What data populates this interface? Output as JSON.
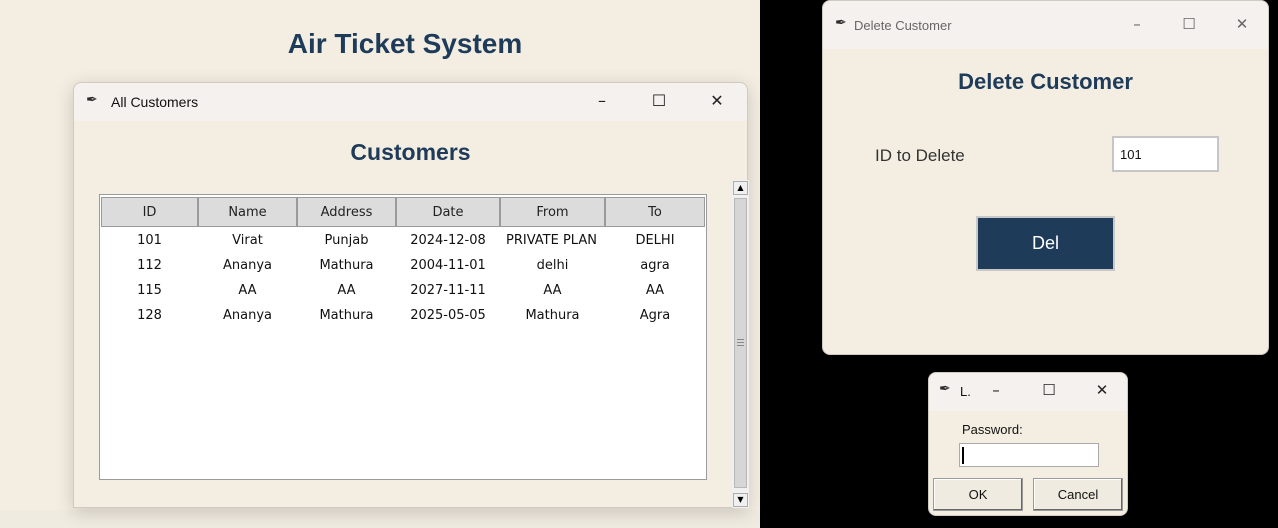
{
  "app": {
    "title": "Air Ticket System"
  },
  "customers_window": {
    "title": "All Customers",
    "heading": "Customers",
    "columns": [
      "ID",
      "Name",
      "Address",
      "Date",
      "From",
      "To"
    ],
    "rows": [
      [
        "101",
        "Virat",
        "Punjab",
        "2024-12-08",
        "PRIVATE PLAN",
        "DELHI"
      ],
      [
        "112",
        "Ananya",
        "Mathura",
        "2004-11-01",
        "delhi",
        "agra"
      ],
      [
        "115",
        "AA",
        "AA",
        "2027-11-11",
        "AA",
        "AA"
      ],
      [
        "128",
        "Ananya",
        "Mathura",
        "2025-05-05",
        "Mathura",
        "Agra"
      ]
    ]
  },
  "delete_window": {
    "title": "Delete Customer",
    "heading": "Delete Customer",
    "id_label": "ID to Delete",
    "id_value": "101",
    "del_label": "Del"
  },
  "login_window": {
    "title": "L.",
    "password_label": "Password:",
    "ok_label": "OK",
    "cancel_label": "Cancel"
  },
  "window_controls": {
    "minimize": "–",
    "maximize": "☐",
    "close": "✕"
  },
  "icons": {
    "app_icon": "feather-icon"
  },
  "colors": {
    "accent": "#1f3b5a",
    "background": "#f4eee2"
  }
}
